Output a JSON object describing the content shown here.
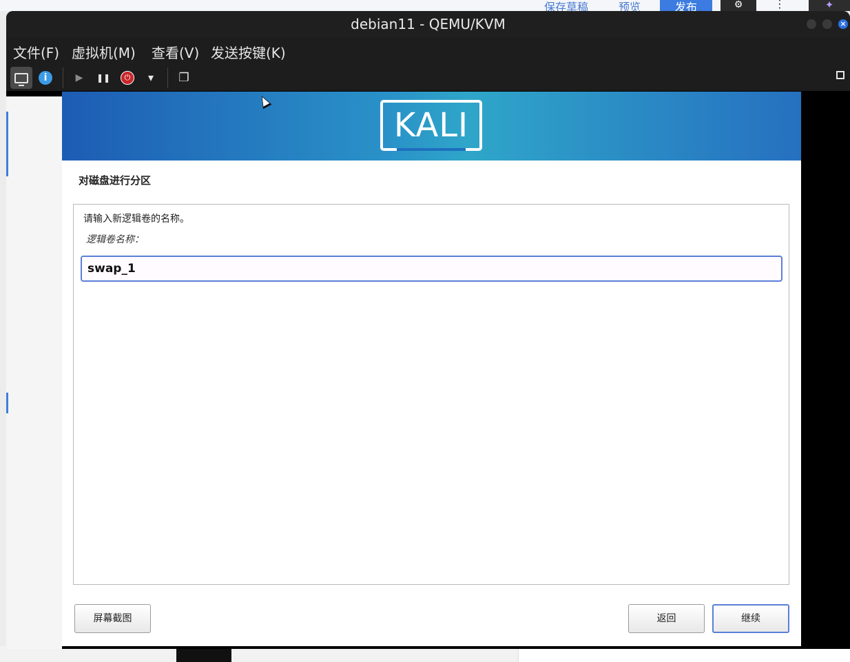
{
  "host_page": {
    "links": [
      "保存草稿",
      "预览"
    ],
    "publish_label": "发布",
    "gear_icon": "⚙",
    "kebab_icon": "⋮",
    "ai_icon": "✦"
  },
  "window": {
    "title": "debian11 - QEMU/KVM",
    "close_glyph": "×"
  },
  "menubar": {
    "items": [
      "文件(F)",
      "虚拟机(M)",
      "查看(V)",
      "发送按键(K)"
    ]
  },
  "toolbar": {
    "info_glyph": "i",
    "play_glyph": "▶",
    "pause_glyph": "❚❚",
    "power_glyph": "⏻",
    "dropdown_glyph": "▾",
    "screens_glyph": "❐"
  },
  "installer": {
    "logo_text": "KALI",
    "section_title": "对磁盘进行分区",
    "prompt": "请输入新逻辑卷的名称。",
    "field_label": "逻辑卷名称：",
    "input_value": "swap_1",
    "buttons": {
      "screenshot": "屏幕截图",
      "back": "返回",
      "continue": "继续"
    }
  },
  "colors": {
    "accent": "#5a7fd8",
    "banner_left": "#1d5cb4",
    "banner_mid": "#2fa6c9",
    "window_bg": "#1d1d1d"
  }
}
